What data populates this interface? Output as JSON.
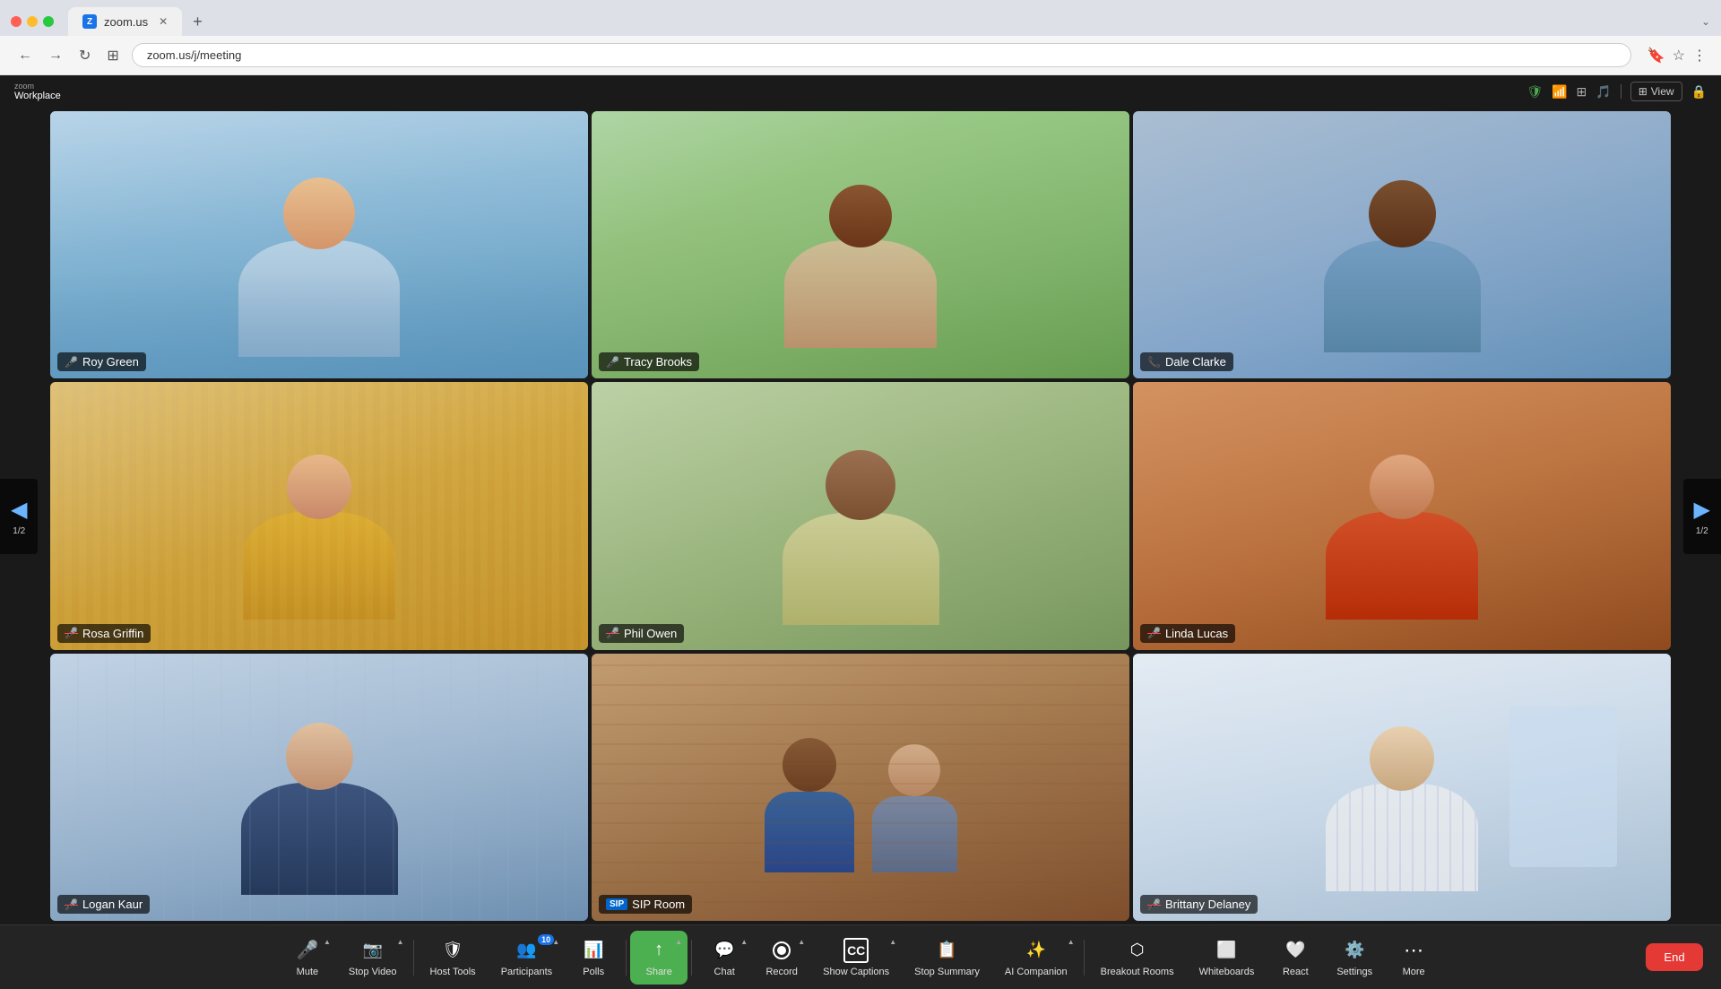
{
  "browser": {
    "tab_title": "zoom.us",
    "tab_icon": "Z",
    "url": "zoom.us/j/meeting",
    "new_tab_label": "+",
    "minimize_icon": "⌄"
  },
  "zoom_header": {
    "logo_top": "zoom",
    "logo_bottom": "Workplace",
    "shield_icon": "🛡",
    "view_label": "View",
    "page_indicator": "1/2"
  },
  "participants": [
    {
      "name": "Roy Green",
      "mic_status": "active",
      "is_speaking": true,
      "bg_class": "roy-bg",
      "mic_icon": "🎤"
    },
    {
      "name": "Tracy Brooks",
      "mic_status": "active",
      "is_speaking": false,
      "bg_class": "tracy-bg",
      "mic_icon": "🎤"
    },
    {
      "name": "Dale Clarke",
      "mic_status": "active",
      "is_speaking": false,
      "bg_class": "dale-bg",
      "phone_icon": "📞"
    },
    {
      "name": "Rosa Griffin",
      "mic_status": "muted",
      "is_speaking": false,
      "bg_class": "rosa-bg",
      "mic_icon": "🎤"
    },
    {
      "name": "Phil Owen",
      "mic_status": "muted",
      "is_speaking": false,
      "bg_class": "phil-bg",
      "mic_icon": "🎤"
    },
    {
      "name": "Linda Lucas",
      "mic_status": "muted",
      "is_speaking": false,
      "bg_class": "linda-bg",
      "mic_icon": "🎤"
    },
    {
      "name": "Logan Kaur",
      "mic_status": "muted",
      "is_speaking": false,
      "bg_class": "logan-bg",
      "mic_icon": "🎤"
    },
    {
      "name": "SIP Room",
      "mic_status": "sip",
      "is_speaking": false,
      "bg_class": "sip-bg",
      "sip_label": "SIP"
    },
    {
      "name": "Brittany Delaney",
      "mic_status": "muted",
      "is_speaking": false,
      "bg_class": "brittany-bg",
      "mic_icon": "🎤"
    }
  ],
  "toolbar": {
    "buttons": [
      {
        "id": "mute",
        "icon": "🎤",
        "label": "Mute",
        "has_caret": true
      },
      {
        "id": "stop-video",
        "icon": "📹",
        "label": "Stop Video",
        "has_caret": true,
        "badge": null
      },
      {
        "id": "host-tools",
        "icon": "🛡",
        "label": "Host Tools",
        "has_caret": false
      },
      {
        "id": "participants",
        "icon": "👥",
        "label": "Participants",
        "has_caret": true,
        "badge": "10"
      },
      {
        "id": "polls",
        "icon": "📊",
        "label": "Polls",
        "has_caret": false
      },
      {
        "id": "share",
        "icon": "↑",
        "label": "Share",
        "has_caret": true,
        "is_green": true
      },
      {
        "id": "chat",
        "icon": "💬",
        "label": "Chat",
        "has_caret": true
      },
      {
        "id": "record",
        "icon": "⏺",
        "label": "Record",
        "has_caret": true
      },
      {
        "id": "show-captions",
        "icon": "CC",
        "label": "Show Captions",
        "has_caret": true
      },
      {
        "id": "stop-summary",
        "icon": "📝",
        "label": "Stop Summary",
        "has_caret": false
      },
      {
        "id": "ai-companion",
        "icon": "✨",
        "label": "AI Companion",
        "has_caret": true
      },
      {
        "id": "breakout-rooms",
        "icon": "⬡",
        "label": "Breakout Rooms",
        "has_caret": false
      },
      {
        "id": "whiteboards",
        "icon": "⬜",
        "label": "Whiteboards",
        "has_caret": false
      },
      {
        "id": "react",
        "icon": "🤍",
        "label": "React",
        "has_caret": false
      },
      {
        "id": "settings",
        "icon": "⚙",
        "label": "Settings",
        "has_caret": false
      },
      {
        "id": "more",
        "icon": "⋯",
        "label": "More",
        "has_caret": false
      }
    ],
    "end_label": "End"
  },
  "nav": {
    "left_arrow": "◀",
    "right_arrow": "▶",
    "page_left": "1/2",
    "page_right": "1/2"
  }
}
